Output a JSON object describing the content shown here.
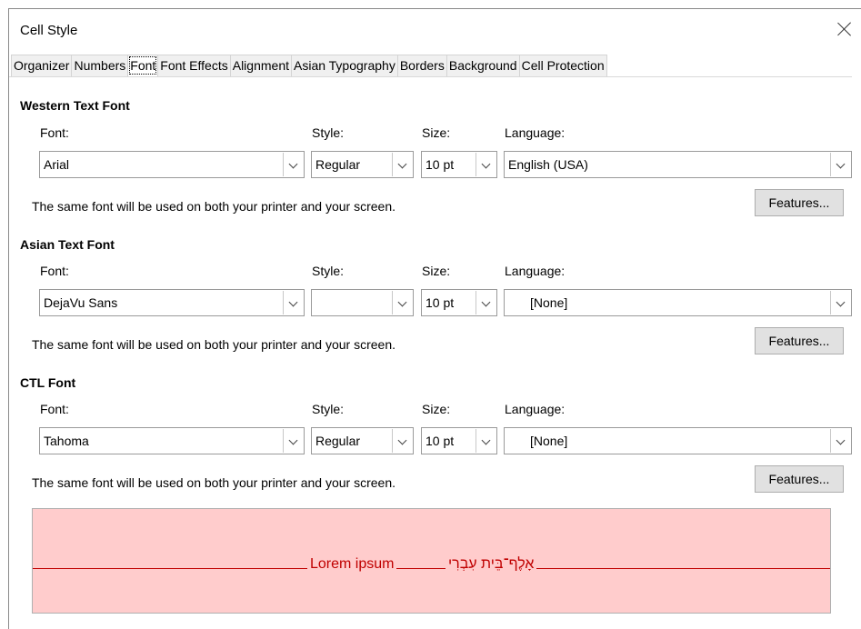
{
  "window": {
    "title": "Cell Style"
  },
  "tabs": [
    "Organizer",
    "Numbers",
    "Font",
    "Font Effects",
    "Alignment",
    "Asian Typography",
    "Borders",
    "Background",
    "Cell Protection"
  ],
  "active_tab": "Font",
  "labels": {
    "font": "Font:",
    "style": "Style:",
    "size": "Size:",
    "language": "Language:"
  },
  "western": {
    "heading": "Western Text Font",
    "font": "Arial",
    "style": "Regular",
    "size": "10 pt",
    "language": "English (USA)",
    "note": "The same font will be used on both your printer and your screen.",
    "features": "Features..."
  },
  "asian": {
    "heading": "Asian Text Font",
    "font": "DejaVu Sans",
    "style": "",
    "size": "10 pt",
    "language": "[None]",
    "note": "The same font will be used on both your printer and your screen.",
    "features": "Features..."
  },
  "ctl": {
    "heading": "CTL Font",
    "font": "Tahoma",
    "style": "Regular",
    "size": "10 pt",
    "language": "[None]",
    "note": "The same font will be used on both your printer and your screen.",
    "features": "Features..."
  },
  "preview": {
    "western_text": "Lorem ipsum",
    "ctl_text": "אָלֶף־בֵּית עִבְרִי"
  }
}
